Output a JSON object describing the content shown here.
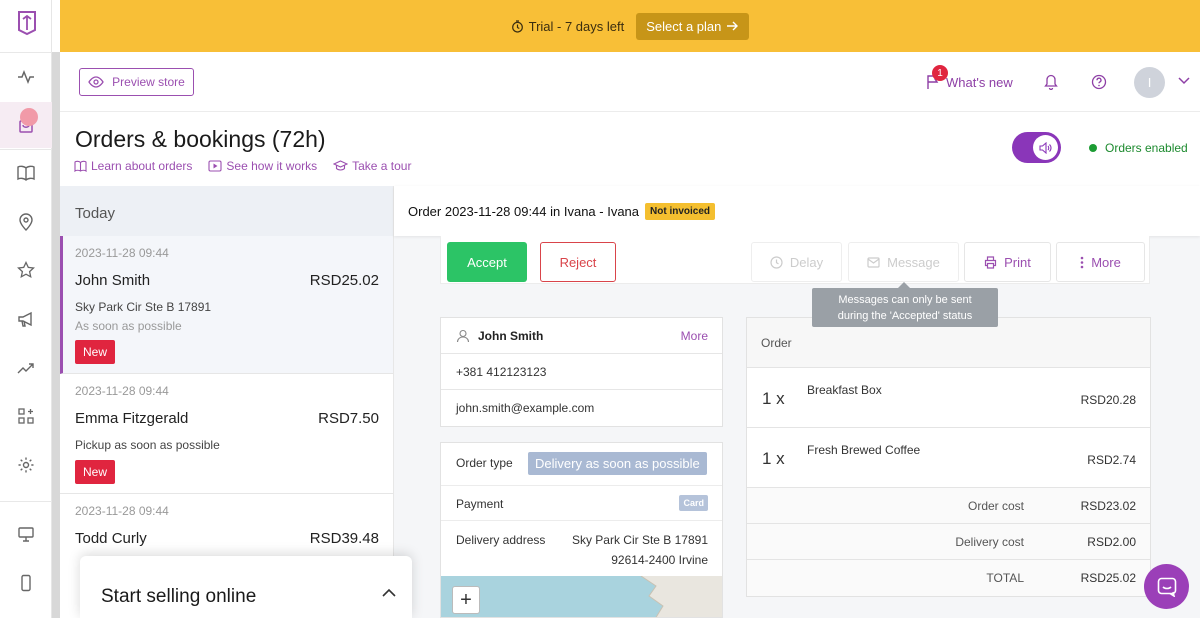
{
  "trial": {
    "text": "Trial - 7 days left",
    "cta": "Select a plan"
  },
  "topbar": {
    "preview_label": "Preview store",
    "whats_new_label": "What's new",
    "whats_new_count": "1",
    "avatar_initial": "I"
  },
  "page": {
    "title": "Orders & bookings (72h)",
    "links": [
      "Learn about orders",
      "See how it works",
      "Take a tour"
    ],
    "orders_status": "Orders enabled"
  },
  "list": {
    "group": "Today",
    "orders": [
      {
        "date": "2023-11-28 09:44",
        "name": "John Smith",
        "price": "RSD25.02",
        "address": "Sky Park Cir Ste B 17891",
        "when": "As soon as possible",
        "badge": "New"
      },
      {
        "date": "2023-11-28 09:44",
        "name": "Emma Fitzgerald",
        "price": "RSD7.50",
        "address": "Pickup as soon as possible",
        "when": "",
        "badge": "New"
      },
      {
        "date": "2023-11-28 09:44",
        "name": "Todd Curly",
        "price": "RSD39.48",
        "address": "",
        "when": "",
        "badge": ""
      }
    ]
  },
  "detail": {
    "header": "Order 2023-11-28 09:44 in Ivana - Ivana",
    "invoice_badge": "Not invoiced",
    "actions": {
      "accept": "Accept",
      "reject": "Reject",
      "delay": "Delay",
      "message": "Message",
      "print": "Print",
      "more": "More"
    },
    "tooltip": [
      "Messages can only be sent",
      "during the 'Accepted' status"
    ],
    "customer": {
      "name": "John Smith",
      "more": "More",
      "phone": "+381 412123123",
      "email": "john.smith@example.com"
    },
    "info": {
      "order_type_label": "Order type",
      "order_type": "Delivery as soon as possible",
      "payment_label": "Payment",
      "payment": "Card",
      "address_label": "Delivery address",
      "address_line1": "Sky Park Cir Ste B 17891",
      "address_line2": "92614-2400 Irvine"
    },
    "summary": {
      "header": "Order",
      "items": [
        {
          "qty": "1 x",
          "name": "Breakfast Box",
          "price": "RSD20.28"
        },
        {
          "qty": "1 x",
          "name": "Fresh Brewed Coffee",
          "price": "RSD2.74"
        }
      ],
      "totals": [
        {
          "label": "Order cost",
          "value": "RSD23.02"
        },
        {
          "label": "Delivery cost",
          "value": "RSD2.00"
        },
        {
          "label": "TOTAL",
          "value": "RSD25.02"
        }
      ]
    }
  },
  "start_selling": {
    "title": "Start selling online"
  },
  "colors": {
    "accent": "#9b4fb0",
    "banner": "#f8bf37",
    "accept": "#2cc466",
    "reject": "#d9444a",
    "new_badge": "#e0253f",
    "enabled": "#1c8a2e"
  },
  "icons": [
    "logo-icon",
    "activity-icon",
    "orders-icon",
    "book-icon",
    "location-icon",
    "star-icon",
    "megaphone-icon",
    "trending-icon",
    "apps-icon",
    "gear-icon",
    "monitor-icon",
    "mobile-icon",
    "timer-icon",
    "arrow-right-icon",
    "eye-icon",
    "flag-icon",
    "bell-icon",
    "help-icon",
    "chevron-down-icon",
    "sound-icon",
    "clock-icon",
    "mail-icon",
    "printer-icon",
    "dots-icon",
    "user-icon",
    "chevron-up-icon",
    "chat-icon"
  ]
}
